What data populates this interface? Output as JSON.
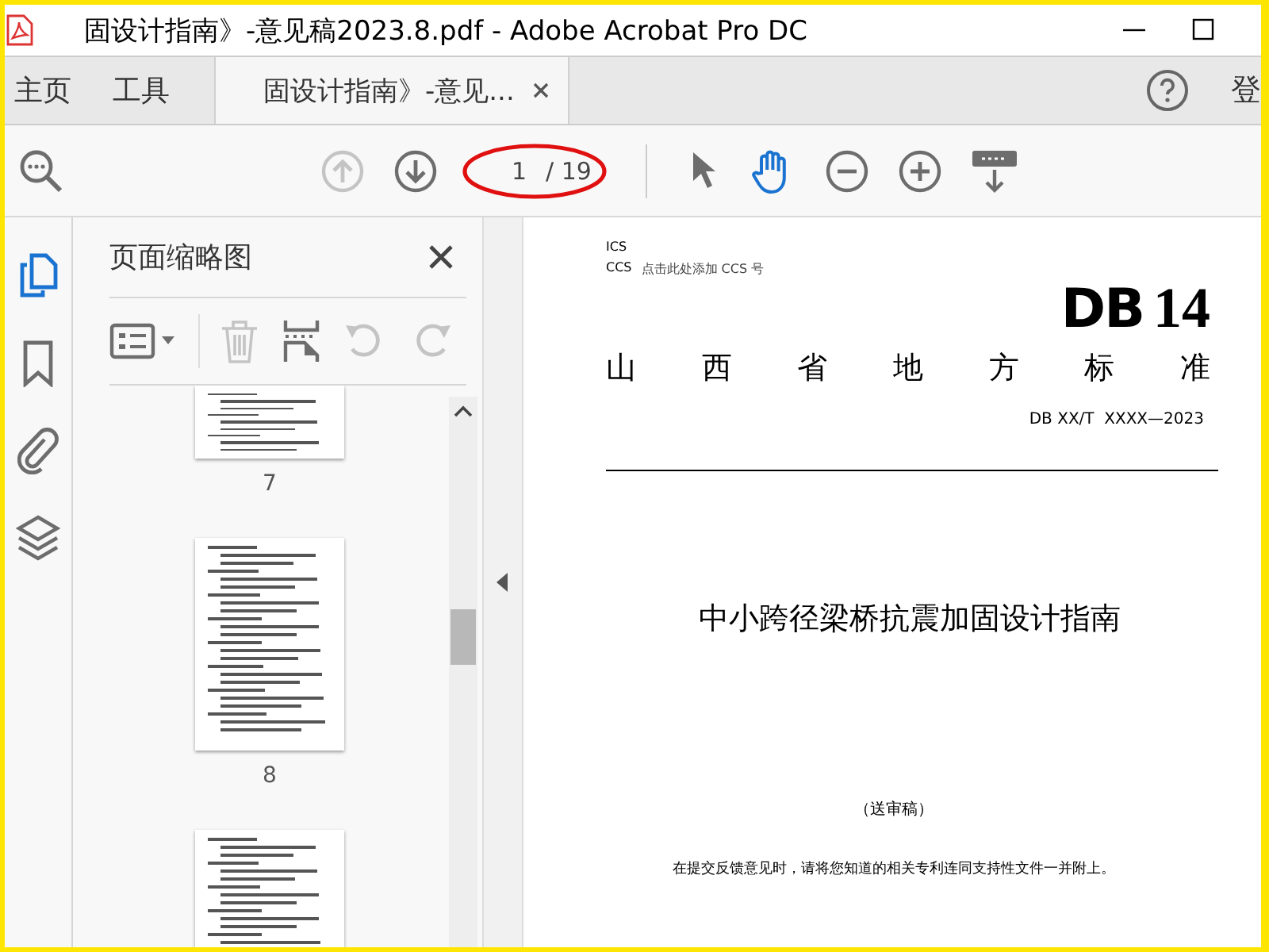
{
  "window": {
    "title": "固设计指南》-意见稿2023.8.pdf - Adobe Acrobat Pro DC"
  },
  "tabs": [
    {
      "label": "主页",
      "selected": false,
      "closable": false
    },
    {
      "label": "工具",
      "selected": false,
      "closable": false
    },
    {
      "label": "固设计指南》-意见...",
      "selected": true,
      "closable": true
    }
  ],
  "account": {
    "label": "登"
  },
  "toolbar": {
    "page_number": "1",
    "page_total": "/ 19",
    "tools": [
      {
        "kind": "find",
        "selected": false,
        "disabled": false
      },
      {
        "kind": "prev",
        "selected": false,
        "disabled": true
      },
      {
        "kind": "next",
        "selected": false,
        "disabled": false
      },
      {
        "kind": "select",
        "selected": false,
        "disabled": false
      },
      {
        "kind": "hand",
        "selected": true,
        "disabled": false
      },
      {
        "kind": "zoom-out",
        "selected": false,
        "disabled": false
      },
      {
        "kind": "zoom-in",
        "selected": false,
        "disabled": false
      },
      {
        "kind": "keyboard",
        "selected": false,
        "disabled": false
      }
    ]
  },
  "rail": [
    {
      "kind": "pages",
      "selected": true
    },
    {
      "kind": "bookmark",
      "selected": false
    },
    {
      "kind": "attachment",
      "selected": false
    },
    {
      "kind": "layers",
      "selected": false
    }
  ],
  "panel": {
    "title": "页面缩略图",
    "tools": [
      {
        "kind": "options",
        "disabled": false
      },
      {
        "kind": "delete",
        "disabled": true
      },
      {
        "kind": "insert",
        "disabled": false
      },
      {
        "kind": "undo",
        "disabled": true
      },
      {
        "kind": "redo",
        "disabled": true
      }
    ],
    "thumbnails": [
      {
        "label": "7"
      },
      {
        "label": "8"
      }
    ]
  },
  "document": {
    "ics": "ICS",
    "ccs": "CCS",
    "ccs_hint": "点击此处添加 CCS 号",
    "code_prefix": "DB",
    "code_number": "14",
    "category": "山西省地方标准",
    "standard_number": "DB XX/T  XXXX—2023",
    "title": "中小跨径梁桥抗震加固设计指南",
    "stage": "（送审稿）",
    "notice": "在提交反馈意见时，请将您知道的相关专利连同支持性文件一并附上。"
  }
}
